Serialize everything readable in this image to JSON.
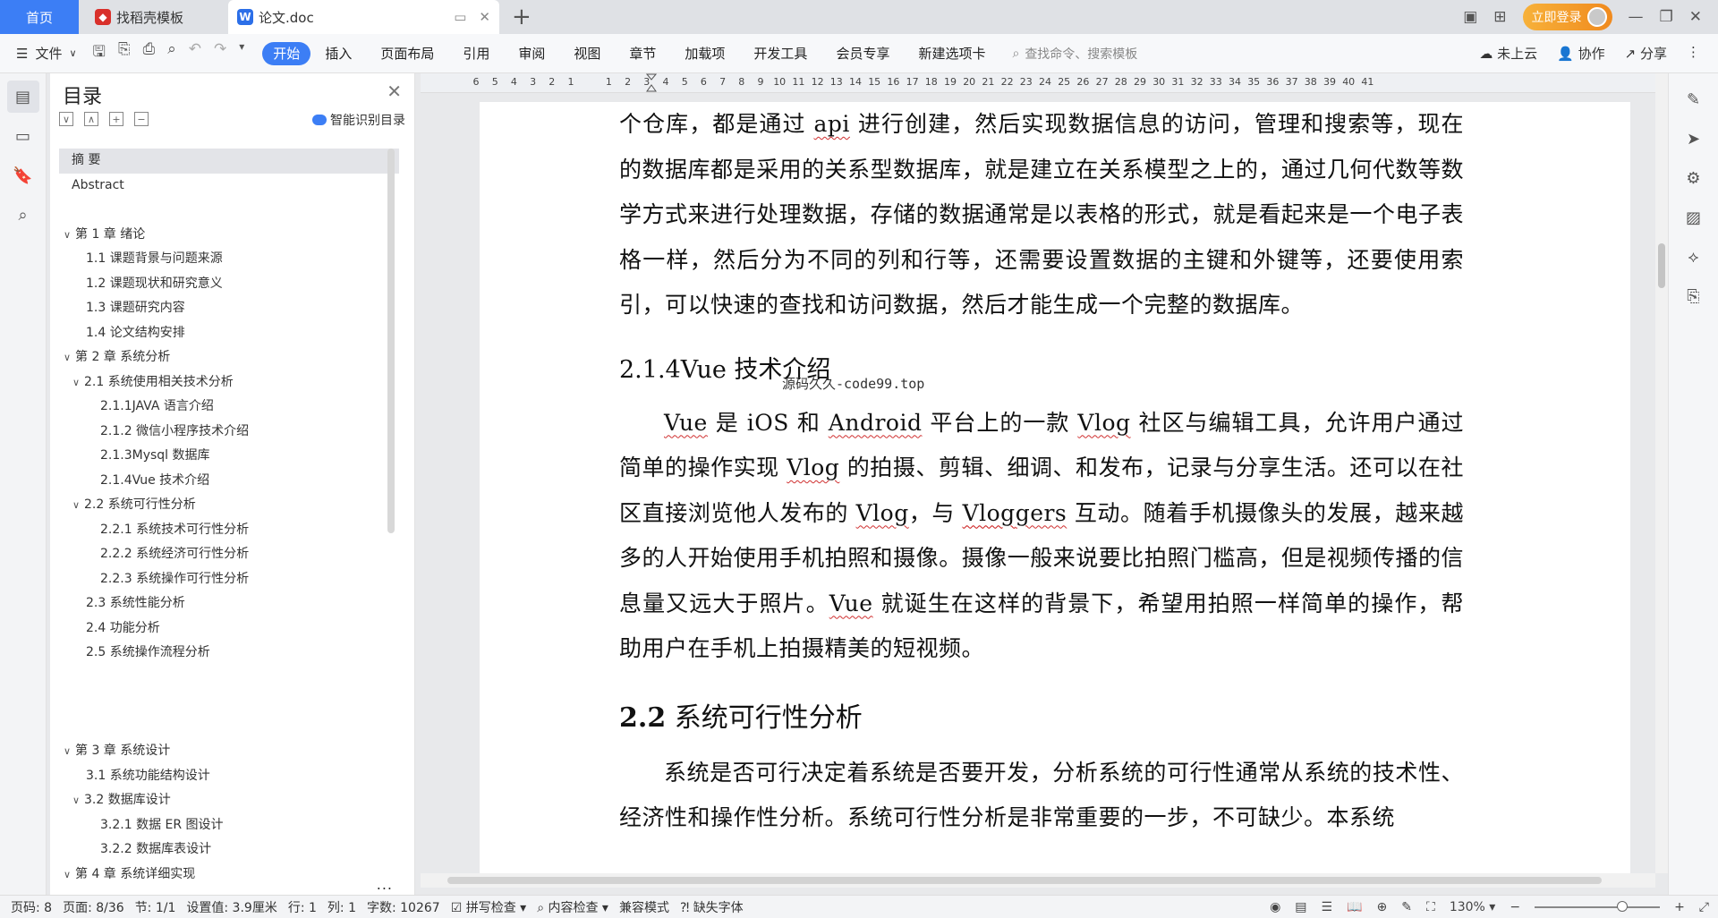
{
  "tabs": {
    "home": "首页",
    "template": "找稻壳模板",
    "doc": "论文.doc"
  },
  "window": {
    "login": "立即登录"
  },
  "ribbon": {
    "file": "文件",
    "menu": [
      "开始",
      "插入",
      "页面布局",
      "引用",
      "审阅",
      "视图",
      "章节",
      "加载项",
      "开发工具",
      "会员专享",
      "新建选项卡"
    ],
    "search_placeholder": "查找命令、搜索模板",
    "cloud": "未上云",
    "collab": "协作",
    "share": "分享"
  },
  "toc": {
    "title": "目录",
    "smart": "智能识别目录",
    "items": [
      {
        "text": "摘    要",
        "level": 1,
        "arrow": "",
        "sel": true
      },
      {
        "text": "Abstract",
        "level": 1,
        "arrow": ""
      },
      {
        "text": "",
        "level": 0,
        "arrow": ""
      },
      {
        "text": "第 1 章  绪论",
        "level": 1,
        "arrow": "∨"
      },
      {
        "text": "1.1 课题背景与问题来源",
        "level": 2,
        "arrow": ""
      },
      {
        "text": "1.2 课题现状和研究意义",
        "level": 2,
        "arrow": ""
      },
      {
        "text": "1.3 课题研究内容",
        "level": 2,
        "arrow": ""
      },
      {
        "text": "1.4 论文结构安排",
        "level": 2,
        "arrow": ""
      },
      {
        "text": "第 2 章  系统分析",
        "level": 1,
        "arrow": "∨"
      },
      {
        "text": "2.1 系统使用相关技术分析",
        "level": 2,
        "arrow": "∨"
      },
      {
        "text": "2.1.1JAVA 语言介绍",
        "level": 3,
        "arrow": ""
      },
      {
        "text": "2.1.2 微信小程序技术介绍",
        "level": 3,
        "arrow": ""
      },
      {
        "text": "2.1.3Mysql 数据库",
        "level": 3,
        "arrow": ""
      },
      {
        "text": "2.1.4Vue 技术介绍",
        "level": 3,
        "arrow": ""
      },
      {
        "text": "2.2 系统可行性分析",
        "level": 2,
        "arrow": "∨"
      },
      {
        "text": "2.2.1 系统技术可行性分析",
        "level": 3,
        "arrow": ""
      },
      {
        "text": "2.2.2 系统经济可行性分析",
        "level": 3,
        "arrow": ""
      },
      {
        "text": "2.2.3 系统操作可行性分析",
        "level": 3,
        "arrow": ""
      },
      {
        "text": "2.3 系统性能分析",
        "level": 2,
        "arrow": ""
      },
      {
        "text": "2.4 功能分析",
        "level": 2,
        "arrow": ""
      },
      {
        "text": "2.5 系统操作流程分析",
        "level": 2,
        "arrow": ""
      },
      {
        "text": "",
        "level": 0,
        "arrow": ""
      },
      {
        "text": "",
        "level": 0,
        "arrow": ""
      },
      {
        "text": "",
        "level": 0,
        "arrow": ""
      },
      {
        "text": "第 3 章  系统设计",
        "level": 1,
        "arrow": "∨"
      },
      {
        "text": "3.1 系统功能结构设计",
        "level": 2,
        "arrow": ""
      },
      {
        "text": "3.2 数据库设计",
        "level": 2,
        "arrow": "∨"
      },
      {
        "text": "3.2.1 数据 ER 图设计",
        "level": 3,
        "arrow": ""
      },
      {
        "text": "3.2.2 数据库表设计",
        "level": 3,
        "arrow": ""
      },
      {
        "text": "第 4 章  系统详细实现",
        "level": 1,
        "arrow": "∨"
      }
    ],
    "more": "..."
  },
  "ruler": [
    "6",
    "5",
    "4",
    "3",
    "2",
    "1",
    "",
    "1",
    "2",
    "3",
    "4",
    "5",
    "6",
    "7",
    "8",
    "9",
    "10",
    "11",
    "12",
    "13",
    "14",
    "15",
    "16",
    "17",
    "18",
    "19",
    "20",
    "21",
    "22",
    "23",
    "24",
    "25",
    "26",
    "27",
    "28",
    "29",
    "30",
    "31",
    "32",
    "33",
    "34",
    "35",
    "36",
    "37",
    "38",
    "39",
    "40",
    "41"
  ],
  "document": {
    "p1": "个仓库，都是通过 api 进行创建，然后实现数据信息的访问，管理和搜索等，现在的数据库都是采用的关系型数据库，就是建立在关系模型之上的，通过几何代数等数学方式来进行处理数据，存储的数据通常是以表格的形式，就是看起来是一个电子表格一样，然后分为不同的列和行等，还需要设置数据的主键和外键等，还要使用索引，可以快速的查找和访问数据，然后才能生成一个完整的数据库。",
    "h_vue": "2.1.4Vue 技术介绍",
    "p2": "Vue 是 iOS 和 Android 平台上的一款 Vlog 社区与编辑工具，允许用户通过简单的操作实现 Vlog 的拍摄、剪辑、细调、和发布，记录与分享生活。还可以在社区直接浏览他人发布的 Vlog，与 Vloggers 互动。随着手机摄像头的发展，越来越多的人开始使用手机拍照和摄像。摄像一般来说要比拍照门槛高，但是视频传播的信息量又远大于照片。Vue 就诞生在这样的背景下，希望用拍照一样简单的操作，帮助用户在手机上拍摄精美的短视频。",
    "h_22_num": "2.2",
    "h_22_text": " 系统可行性分析",
    "p3": "系统是否可行决定着系统是否要开发，分析系统的可行性通常从系统的技术性、经济性和操作性分析。系统可行性分析是非常重要的一步，不可缺少。本系统",
    "watermark": "源码久久-code99.top"
  },
  "status": {
    "page_code": "页码: 8",
    "page": "页面: 8/36",
    "section": "节: 1/1",
    "setting": "设置值: 3.9厘米",
    "row": "行: 1",
    "col": "列: 1",
    "words": "字数: 10267",
    "spell": "拼写检查",
    "content_check": "内容检查",
    "compat": "兼容模式",
    "missing_font": "缺失字体",
    "zoom": "130%"
  }
}
